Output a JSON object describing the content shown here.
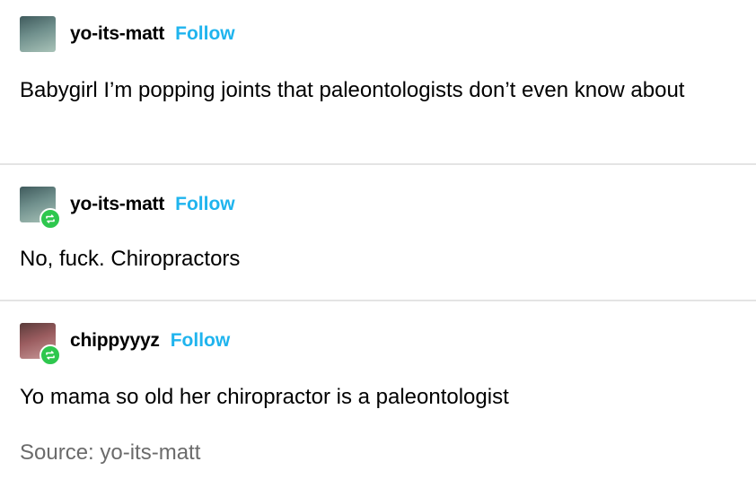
{
  "posts": [
    {
      "username": "yo-its-matt",
      "follow_label": "Follow",
      "text": "Babygirl I’m popping joints that paleontologists don’t even know about"
    },
    {
      "username": "yo-its-matt",
      "follow_label": "Follow",
      "text": "No, fuck. Chiropractors"
    },
    {
      "username": "chippyyyz",
      "follow_label": "Follow",
      "text": "Yo mama so old her chiropractor is a paleontologist"
    }
  ],
  "source": {
    "label": "Source: yo-its-matt"
  },
  "colors": {
    "follow": "#1fb4ee",
    "reblog_badge": "#2ec74e",
    "divider": "#e4e4e4",
    "source_text": "#6b6b6b"
  },
  "icons": {
    "reblog": "reblog-icon"
  }
}
